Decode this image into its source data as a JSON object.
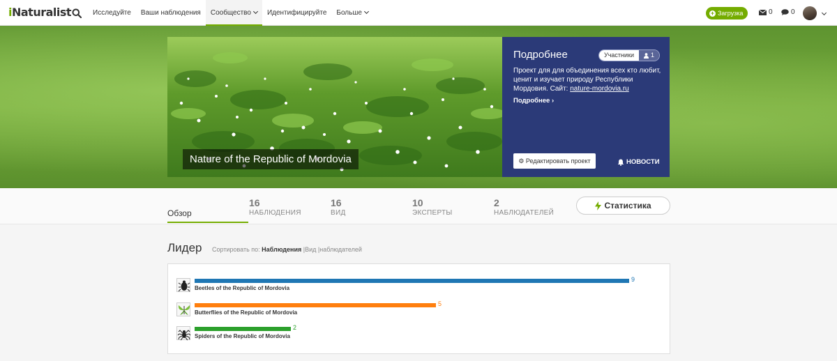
{
  "header": {
    "logo_prefix": "i",
    "logo_rest": "Naturalist",
    "nav": [
      {
        "label": "Исследуйте",
        "dropdown": false,
        "active": false
      },
      {
        "label": "Ваши наблюдения",
        "dropdown": false,
        "active": false
      },
      {
        "label": "Сообщество",
        "dropdown": true,
        "active": true
      },
      {
        "label": "Идентифицируйте",
        "dropdown": false,
        "active": false
      },
      {
        "label": "Больше",
        "dropdown": true,
        "active": false
      }
    ],
    "upload_label": "Загрузка",
    "messages_count": "0",
    "notifications_count": "0",
    "accent": "#74ac00"
  },
  "project": {
    "title": "Nature of the Republic of Mordovia",
    "about_heading": "Подробнее",
    "members_label": "Участники",
    "members_count": "1",
    "description": "Проект для для объединения всех кто любит, ценит и изучает природу Республики Мордовия. Сайт: ",
    "site_link": "nature-mordovia.ru",
    "more_link": "Подробнее",
    "edit_button": "Редактировать проект",
    "news_label": "НОВОСТИ",
    "panel_color": "#2b3a78"
  },
  "stats": {
    "overview_tab": "Обзор",
    "items": [
      {
        "value": "16",
        "label": "НАБЛЮДЕНИЯ"
      },
      {
        "value": "16",
        "label": "ВИД"
      },
      {
        "value": "10",
        "label": "ЭКСПЕРТЫ"
      },
      {
        "value": "2",
        "label": "НАБЛЮДАТЕЛЕЙ"
      }
    ],
    "stats_button": "Статистика"
  },
  "leaderboard": {
    "title": "Лидер",
    "sort_prefix": "Сортировать по:",
    "sort_options": [
      "Наблюдения",
      "Вид",
      "наблюдателей"
    ],
    "sort_active": "Наблюдения",
    "rows": [
      {
        "name": "Beetles of the Republic of Mordovia",
        "value": 9,
        "color": "#1f77b4",
        "icon": "beetle-icon"
      },
      {
        "name": "Butterflies of the Republic of Mordovia",
        "value": 5,
        "color": "#ff7f0e",
        "icon": "butterfly-icon"
      },
      {
        "name": "Spiders of the Republic of Mordovia",
        "value": 2,
        "color": "#2ca02c",
        "icon": "spider-icon"
      }
    ],
    "max_value": 9
  }
}
